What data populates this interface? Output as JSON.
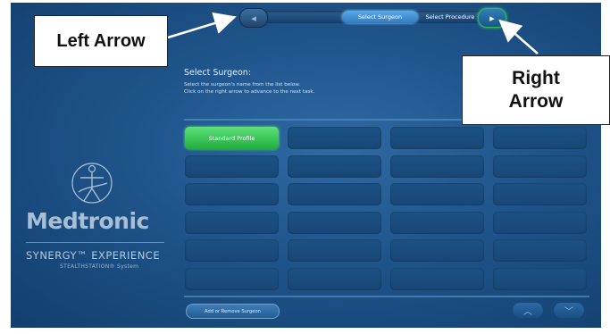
{
  "nav": {
    "left_arrow_glyph": "◂",
    "right_arrow_glyph": "▸",
    "steps": [
      "Select Surgeon",
      "Select Procedure"
    ]
  },
  "header": {
    "title": "Select Surgeon:",
    "instruction_line1": "Select the surgeon's name from the list below.",
    "instruction_line2": "Click on the right arrow to advance to the next task."
  },
  "grid": {
    "cells": [
      "Standard Profile",
      "",
      "",
      "",
      "",
      "",
      "",
      "",
      "",
      "",
      "",
      "",
      "",
      "",
      "",
      "",
      "",
      "",
      "",
      "",
      "",
      "",
      "",
      ""
    ]
  },
  "footer": {
    "add_button": "Add or Remove Surgeon",
    "scroll_up_glyph": "︿",
    "scroll_down_glyph": "﹀"
  },
  "branding": {
    "company": "Medtronic",
    "product": "SYNERGY™ EXPERIENCE",
    "system": "STEALTHSTATION® System"
  },
  "annotations": {
    "left_arrow": "Left Arrow",
    "right_arrow_line1": "Right",
    "right_arrow_line2": "Arrow"
  },
  "colors": {
    "accent_green": "#1fae3d",
    "background_blue": "#1f548a",
    "active_step": "#2f7cc2"
  }
}
